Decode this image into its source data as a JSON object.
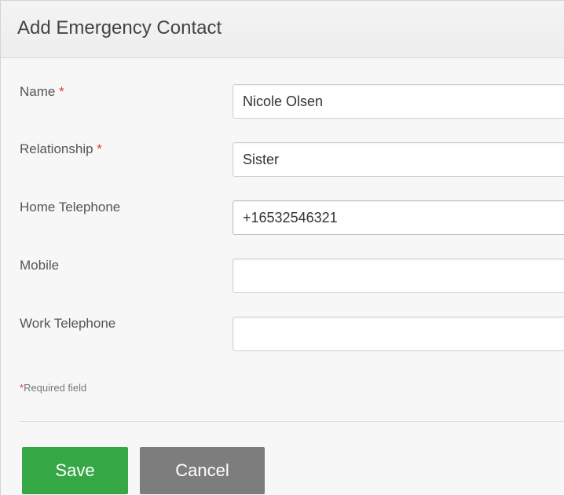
{
  "dialog": {
    "title": "Add Emergency Contact"
  },
  "fields": {
    "name": {
      "label": "Name",
      "required_mark": "*",
      "value": "Nicole Olsen"
    },
    "relationship": {
      "label": "Relationship",
      "required_mark": "*",
      "value": "Sister"
    },
    "home_telephone": {
      "label": "Home Telephone",
      "value": "+16532546321"
    },
    "mobile": {
      "label": "Mobile",
      "value": ""
    },
    "work_telephone": {
      "label": "Work Telephone",
      "value": ""
    }
  },
  "required_note": {
    "mark": "*",
    "text": "Required field"
  },
  "buttons": {
    "save": "Save",
    "cancel": "Cancel"
  },
  "colors": {
    "save_button": "#35a845",
    "cancel_button": "#7d7d7d",
    "required_mark": "#e0393e"
  }
}
